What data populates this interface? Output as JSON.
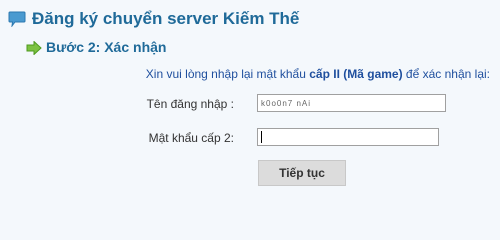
{
  "page": {
    "title": "Đăng ký chuyển server Kiếm Thế",
    "title_color": "#1f6a99"
  },
  "step": {
    "label": "Bước 2: Xác nhận"
  },
  "instruction": {
    "prefix": "Xin vui lòng nhập lại mật khẩu ",
    "emphasis": "cấp II (Mã game)",
    "suffix": " để xác nhận lại:",
    "color": "#1f4f9e"
  },
  "form": {
    "username_label": "Tên đăng nhập :",
    "username_value": "k0o0n7 nAi",
    "password_label": "Mật khẩu cấp 2:",
    "password_value": "",
    "submit_label": "Tiếp tục"
  },
  "icons": {
    "header": "chat-bubble-icon",
    "step": "arrow-right-icon"
  }
}
